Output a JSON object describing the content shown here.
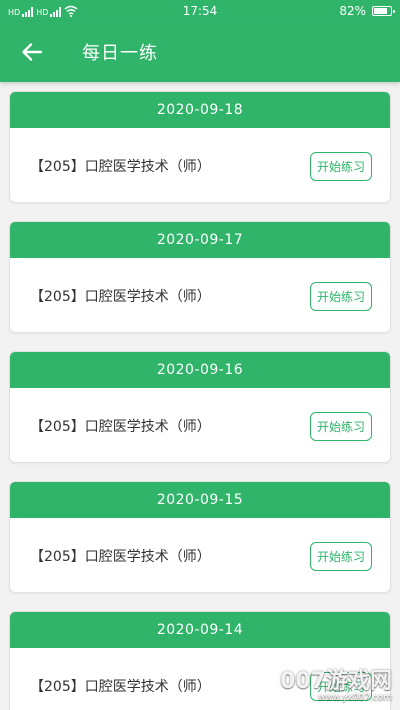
{
  "status_bar": {
    "signal_1": "HD",
    "signal_2": "HD",
    "time": "17:54",
    "battery_percent": "82%",
    "battery_level": 0.82
  },
  "app_bar": {
    "title": "每日一练",
    "back_icon": "arrow-left-icon"
  },
  "practices": [
    {
      "date": "2020-09-18",
      "title": "【205】口腔医学技术（师）",
      "button": "开始练习"
    },
    {
      "date": "2020-09-17",
      "title": "【205】口腔医学技术（师）",
      "button": "开始练习"
    },
    {
      "date": "2020-09-16",
      "title": "【205】口腔医学技术（师）",
      "button": "开始练习"
    },
    {
      "date": "2020-09-15",
      "title": "【205】口腔医学技术（师）",
      "button": "开始练习"
    },
    {
      "date": "2020-09-14",
      "title": "【205】口腔医学技术（师）",
      "button": "开始练习"
    }
  ],
  "watermark": {
    "main": "007游戏网",
    "sub": "www.yx007.com"
  },
  "colors": {
    "primary": "#2fb46a",
    "background": "#f2f2f2"
  }
}
